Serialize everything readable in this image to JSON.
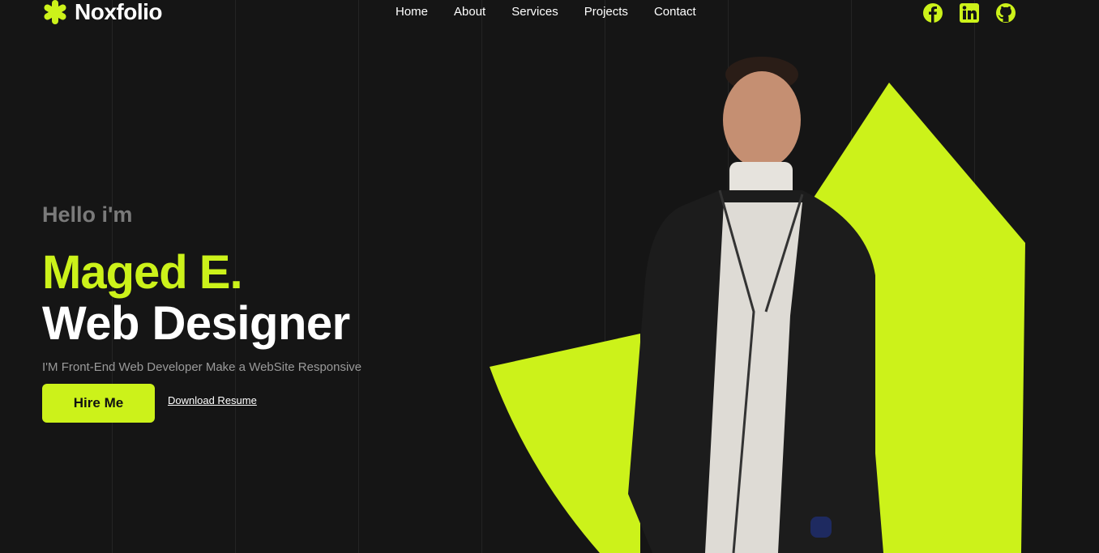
{
  "brand": {
    "name": "Noxfolio",
    "logo_icon": "asterisk-icon"
  },
  "nav": {
    "items": [
      "Home",
      "About",
      "Services",
      "Projects",
      "Contact"
    ]
  },
  "socials": [
    {
      "icon": "facebook-icon"
    },
    {
      "icon": "linkedin-icon"
    },
    {
      "icon": "github-icon"
    }
  ],
  "hero": {
    "greeting": "Hello i'm",
    "name": "Maged E.",
    "role": "Web Designer",
    "tagline": "I'M Front-End Web Developer Make a WebSite Responsive",
    "hire_label": "Hire Me",
    "download_label": "Download Resume"
  },
  "colors": {
    "background": "#151515",
    "accent": "#ccf21a",
    "muted": "#7a7a7a"
  }
}
